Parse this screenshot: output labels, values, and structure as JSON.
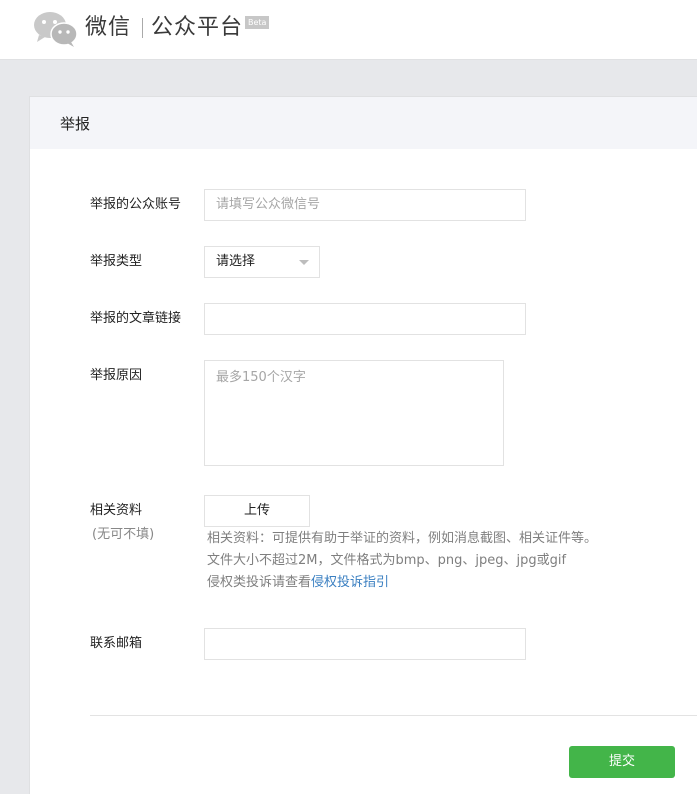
{
  "header": {
    "brand": "微信",
    "platform": "公众平台",
    "badge": "Beta",
    "logo_icon": "wechat-logo-icon"
  },
  "form": {
    "title": "举报",
    "account": {
      "label": "举报的公众账号",
      "placeholder": "请填写公众微信号",
      "value": ""
    },
    "type": {
      "label": "举报类型",
      "selected": "请选择",
      "icon": "chevron-down-icon"
    },
    "article_link": {
      "label": "举报的文章链接",
      "value": ""
    },
    "reason": {
      "label": "举报原因",
      "placeholder": "最多150个汉字",
      "value": ""
    },
    "materials": {
      "label": "相关资料",
      "sublabel": "(无可不填)",
      "upload_label": "上传",
      "help_line1": "相关资料：可提供有助于举证的资料，例如消息截图、相关证件等。",
      "help_line2": "文件大小不超过2M，文件格式为bmp、png、jpeg、jpg或gif",
      "help_line3_prefix": "侵权类投诉请查看",
      "help_link": "侵权投诉指引"
    },
    "email": {
      "label": "联系邮箱",
      "value": ""
    },
    "submit_label": "提交"
  },
  "colors": {
    "accent_green": "#43b549",
    "link_blue": "#3a7fc1",
    "page_bg": "#e7e8eb",
    "panel_head_bg": "#f4f5f9"
  }
}
